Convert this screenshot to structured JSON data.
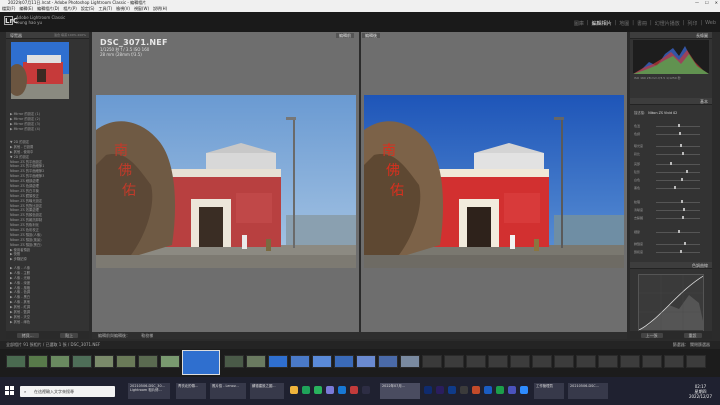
{
  "titlebar": {
    "title": "2022年07月11日.lrcat - Adobe Photoshop Lightroom Classic - 編輯相片"
  },
  "menubar": {
    "items": [
      "檔案(F)",
      "編輯(E)",
      "編輯相片(D)",
      "相片(P)",
      "設定(S)",
      "工具(T)",
      "檢視(V)",
      "視窗(W)",
      "說明(H)"
    ]
  },
  "identity": {
    "logo": "LrC",
    "app": "Adobe Lightroom Classic",
    "user": "leung hao yu"
  },
  "modules": [
    "圖庫",
    "編輯相片",
    "地圖",
    "書冊",
    "幻燈片播放",
    "列印",
    "Web"
  ],
  "left_panel": {
    "navigator_label": "導覽器",
    "navigator_zoom": "適合  填滿  100%  200%",
    "tree_top": [
      "▶ Mirror 的設定 (1)",
      "▶ Mirror 的設定 (2)",
      "▶ Mirror 的設定 (3)",
      "▶ Mirror 的設定 (4)"
    ],
    "tree_mid": [
      "▼ 2D 的設定",
      "   ▶ 其他 - 已設置",
      "   ▶ 其他 - 使用中",
      "▼ 2D 的設定",
      "   Nikon ZS 的平面設定",
      "   Nikon ZS 的平面細節1",
      "   Nikon ZS 的平面細節2",
      "   Nikon ZS 的平面細節3",
      "   Nikon ZS 細部處理",
      "   Nikon ZS 色調處理",
      "   Nikon ZS 的白平衡",
      "   Nikon ZS 鏡頭校正",
      "   Nikon ZS 的曝光設定",
      "   Nikon ZS 的對比設定",
      "   Nikon ZS 效果處理",
      "   Nikon ZS 的顏色設定",
      "   Nikon ZS 的雜訊抑制",
      "   Nikon ZS 的銳利化",
      "   Nikon ZS 色彩校正",
      "   Nikon ZS 預設(人像)",
      "   Nikon ZS 預設(風景)",
      "   Nikon ZS 預設(黑白)",
      "▶ 使用者預設",
      "▶ 快照",
      "▶ 步驟記錄"
    ],
    "tree_bottom": [
      "▶ 人像 - 人像",
      "▶ 人像 - 主體",
      "▶ 人像 - 光線",
      "▶ 人像 - 深度",
      "▶ 人像 - 風格",
      "▶ 人像 - 色調",
      "▶ 人像 - 黑白",
      "▶ 人像 - 其他",
      "▶ 其他 - 紅調",
      "▶ 其他 - 藍調",
      "▶ 其他 - 天空",
      "▶ 其他 - 綠色"
    ],
    "copy_button": "拷貝...",
    "paste_button": "貼上"
  },
  "center": {
    "filename": "DSC_3071.NEF",
    "meta_line1": "1/1250 秒    f / 3.5    ISO 160",
    "meta_line2": "28 mm (28mm f/3.5)",
    "before_tag": "編輯前",
    "after_tag": "編輯後"
  },
  "center_toolbar": {
    "label": "編輯前與編輯後：",
    "soft_proof": "軟校樣"
  },
  "right_panel": {
    "histogram_label": "長條圖",
    "histogram_readout": "ISO 160   28 mm   f/3.5   1/1250 秒",
    "basic_label": "基本",
    "profile_label": "描述檔：",
    "profile_value": "Nikon ZS Vivid 02",
    "sliders": [
      "色溫",
      "色調",
      "曝光度",
      "對比",
      "亮部",
      "陰影",
      "白色",
      "黑色",
      "紋理",
      "清晰度",
      "去朦朧",
      "細節",
      "鮮豔度",
      "飽和度"
    ],
    "tone_curve_label": "色調曲線",
    "prev_button": "上一張",
    "reset_button": "重設"
  },
  "filmstrip": {
    "info": "全部相片   91 張相片 / 已選取 1 張 / DSC_3071.NEF",
    "filter_label": "篩選器：",
    "filter_value": "關閉篩選器"
  },
  "taskbar": {
    "search_placeholder": "在這裡輸入文字來搜尋",
    "apps": [
      {
        "label": "20210506-DSC_30...",
        "color": "#37394a"
      },
      {
        "label": "Lightroom 相片修...",
        "color": "#37394a"
      },
      {
        "label": "青衣北的傳...",
        "color": "#37394a"
      },
      {
        "label": "照片檢 - Lenov...",
        "color": "#37394a"
      },
      {
        "label": "蘇德建設之圖...",
        "color": "#37394a"
      },
      {
        "label": "2022年07月...",
        "color": "#37394a"
      },
      {
        "label": "工作管理員",
        "color": "#37394a"
      },
      {
        "label": "20210506-DSC...",
        "color": "#37394a"
      }
    ],
    "clock_time": "02:17",
    "clock_day": "星期四",
    "clock_date": "2022/12/27"
  },
  "colors": {
    "accent": "#e6e6e6",
    "panel": "#333333",
    "background": "#2b2b2b",
    "center": "#6e6e6e"
  }
}
